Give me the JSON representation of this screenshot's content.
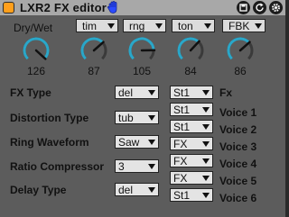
{
  "titlebar": {
    "title": "LXR2 FX editor"
  },
  "header": {
    "drywet_label": "Dry/Wet",
    "selects": [
      "tim",
      "rng",
      "ton",
      "FBK"
    ]
  },
  "knobs": [
    {
      "name": "dry-wet",
      "value": "126",
      "level": 0.99
    },
    {
      "name": "tim",
      "value": "87",
      "level": 0.68
    },
    {
      "name": "rng",
      "value": "105",
      "level": 0.83
    },
    {
      "name": "ton",
      "value": "84",
      "level": 0.66
    },
    {
      "name": "fbk",
      "value": "86",
      "level": 0.68
    }
  ],
  "params": [
    {
      "label": "FX Type",
      "value": "del"
    },
    {
      "label": "Distortion Type",
      "value": "tub"
    },
    {
      "label": "Ring Waveform",
      "value": "Saw"
    },
    {
      "label": "Ratio Compressor",
      "value": "3"
    },
    {
      "label": "Delay Type",
      "value": "del"
    }
  ],
  "routing": [
    {
      "value": "St1",
      "voice": "Fx"
    },
    {
      "value": "St1",
      "voice": "Voice 1"
    },
    {
      "value": "St1",
      "voice": "Voice 2"
    },
    {
      "value": "FX",
      "voice": "Voice 3"
    },
    {
      "value": "FX",
      "voice": "Voice 4"
    },
    {
      "value": "FX",
      "voice": "Voice 5"
    },
    {
      "value": "St1",
      "voice": "Voice 6"
    }
  ],
  "colors": {
    "accent": "#ff9f1c",
    "knob_ring": "#2aa7c9",
    "panel": "#5c5c5c",
    "titlebar": "#a8a8a8"
  }
}
